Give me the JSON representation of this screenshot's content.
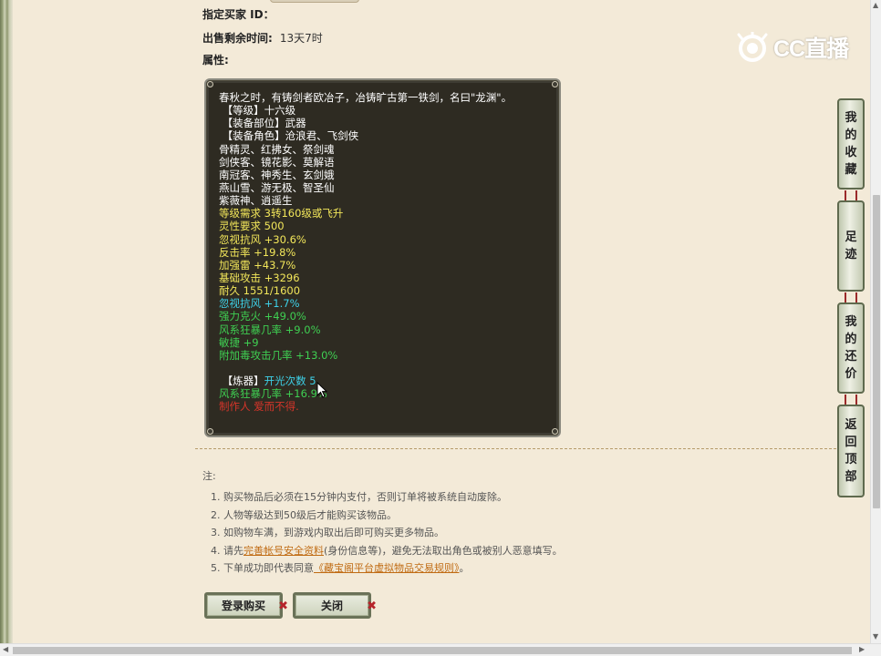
{
  "fields": {
    "buyer_id_label": "指定买家 ID：",
    "time_label": "出售剩余时间:",
    "time_value": "13天7时",
    "attr_label": "属性:"
  },
  "item_lines": [
    {
      "text": "春秋之时，有铸剑者欧冶子，冶铸旷古第一铁剑，名曰\"龙渊\"。",
      "color": "#ffffff"
    },
    {
      "text": " 【等级】十六级",
      "color": "#ffffff"
    },
    {
      "text": " 【装备部位】武器",
      "color": "#ffffff"
    },
    {
      "text": " 【装备角色】沧浪君、飞剑侠",
      "color": "#ffffff"
    },
    {
      "text": "骨精灵、红拂女、祭剑魂",
      "color": "#ffffff"
    },
    {
      "text": "剑侠客、镜花影、莫解语",
      "color": "#ffffff"
    },
    {
      "text": "南冠客、神秀生、玄剑娥",
      "color": "#ffffff"
    },
    {
      "text": "燕山雪、游无极、智圣仙",
      "color": "#ffffff"
    },
    {
      "text": "紫薇神、逍遥生",
      "color": "#ffffff"
    },
    {
      "text": "等级需求 3转160级或飞升",
      "color": "#f2e65a"
    },
    {
      "text": "灵性要求 500",
      "color": "#f2e65a"
    },
    {
      "text": "忽视抗风 +30.6%",
      "color": "#f2e65a"
    },
    {
      "text": "反击率 +19.8%",
      "color": "#f2e65a"
    },
    {
      "text": "加强雷 +43.7%",
      "color": "#f2e65a"
    },
    {
      "text": "基础攻击 +3296",
      "color": "#f2e65a"
    },
    {
      "text": "耐久 1551/1600",
      "color": "#f2e65a"
    },
    {
      "text": "忽视抗风 +1.7%",
      "color": "#3ed1e8"
    },
    {
      "text": "强力克火 +49.0%",
      "color": "#3fcf52"
    },
    {
      "text": "风系狂暴几率 +9.0%",
      "color": "#3fcf52"
    },
    {
      "text": "敏捷 +9",
      "color": "#3fcf52"
    },
    {
      "text": "附加毒攻击几率 +13.0%",
      "color": "#3fcf52"
    },
    {
      "text": "",
      "color": "#ffffff"
    }
  ],
  "refine_line": {
    "prefix": " 【炼器】",
    "label": "开光次数",
    "value": " 5"
  },
  "refine_lines": [
    {
      "text": "风系狂暴几率 +16.9%",
      "color": "#3fcf52"
    },
    {
      "text": "制作人 爱而不得.",
      "color": "#d6352a"
    }
  ],
  "notes": {
    "title": "注:",
    "items": [
      {
        "pre": "1. 购买物品后必须在15分钟内支付，否则订单将被系统自动废除。",
        "link": "",
        "post": ""
      },
      {
        "pre": "2. 人物等级达到50级后才能购买该物品。",
        "link": "",
        "post": ""
      },
      {
        "pre": "3. 如购物车满，到游戏内取出后即可购买更多物品。",
        "link": "",
        "post": ""
      },
      {
        "pre": "4. 请先",
        "link": "完善帐号安全资料",
        "post": "(身份信息等)，避免无法取出角色或被别人恶意填写。"
      },
      {
        "pre": "5. 下单成功即代表同意",
        "link": "《藏宝阁平台虚拟物品交易规则》",
        "post": "。"
      }
    ]
  },
  "buttons": {
    "login_buy": "登录购买",
    "close": "关闭"
  },
  "logo": {
    "text": "CC直播"
  },
  "side_nav": [
    {
      "label": "我的收藏",
      "chars": [
        "我",
        "的",
        "收",
        "藏"
      ]
    },
    {
      "label": "足迹",
      "chars": [
        "足",
        "迹"
      ]
    },
    {
      "label": "我的还价",
      "chars": [
        "我",
        "的",
        "还",
        "价"
      ]
    },
    {
      "label": "返回顶部",
      "chars": [
        "返",
        "回",
        "顶",
        "部"
      ]
    }
  ],
  "colors": {
    "refine_label": "#3ed1e8",
    "refine_prefix": "#ffffff",
    "link": "#c06b13",
    "close_mark": "#b6242b"
  }
}
